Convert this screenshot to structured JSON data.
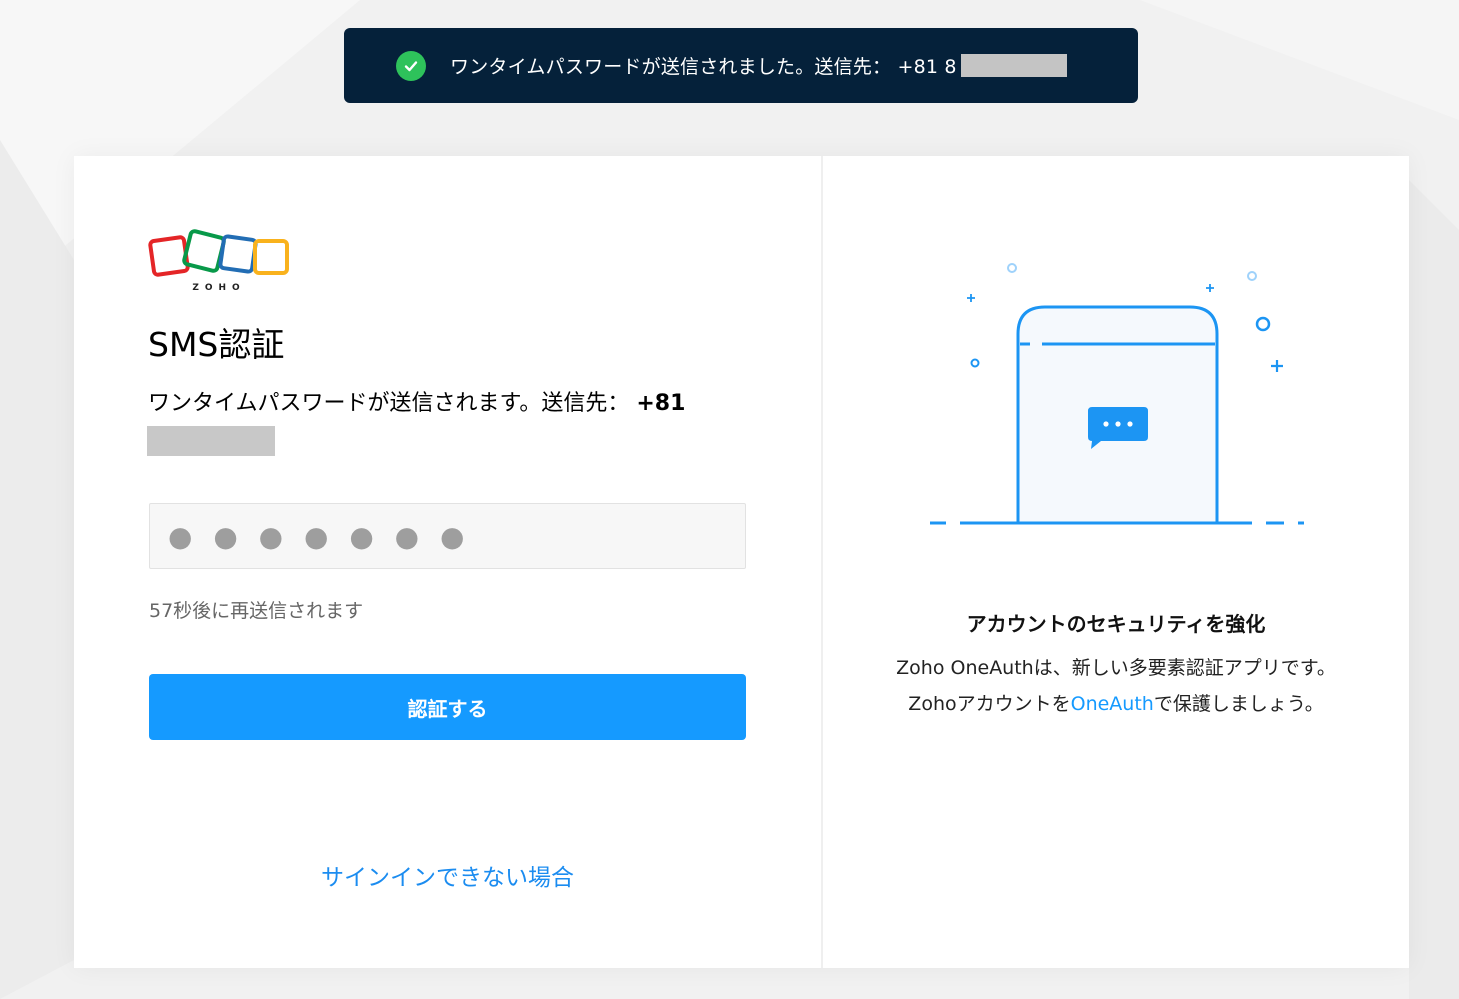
{
  "toast": {
    "message": "ワンタイムパスワードが送信されました。送信先： +81 8",
    "icon": "check-circle-icon"
  },
  "logo": {
    "text": "ZOHO"
  },
  "form": {
    "title": "SMS認証",
    "description": "ワンタイムパスワードが送信されます。送信先：",
    "phone_prefix": "+81",
    "otp_placeholder": "● ● ● ● ● ● ●",
    "resend_text": "57秒後に再送信されます",
    "verify_label": "認証する",
    "help_link": "サインインできない場合"
  },
  "promo": {
    "title": "アカウントのセキュリティを強化",
    "text_before": "Zoho OneAuthは、新しい多要素認証アプリです。Zohoアカウントを",
    "link": "OneAuth",
    "text_after": "で保護しましょう。"
  },
  "colors": {
    "primary": "#159aff",
    "toast_bg": "#05213a",
    "success": "#2ec25b",
    "zoho_red": "#e42527",
    "zoho_green": "#089949",
    "zoho_blue": "#226db4",
    "zoho_yellow": "#f9b21d"
  }
}
